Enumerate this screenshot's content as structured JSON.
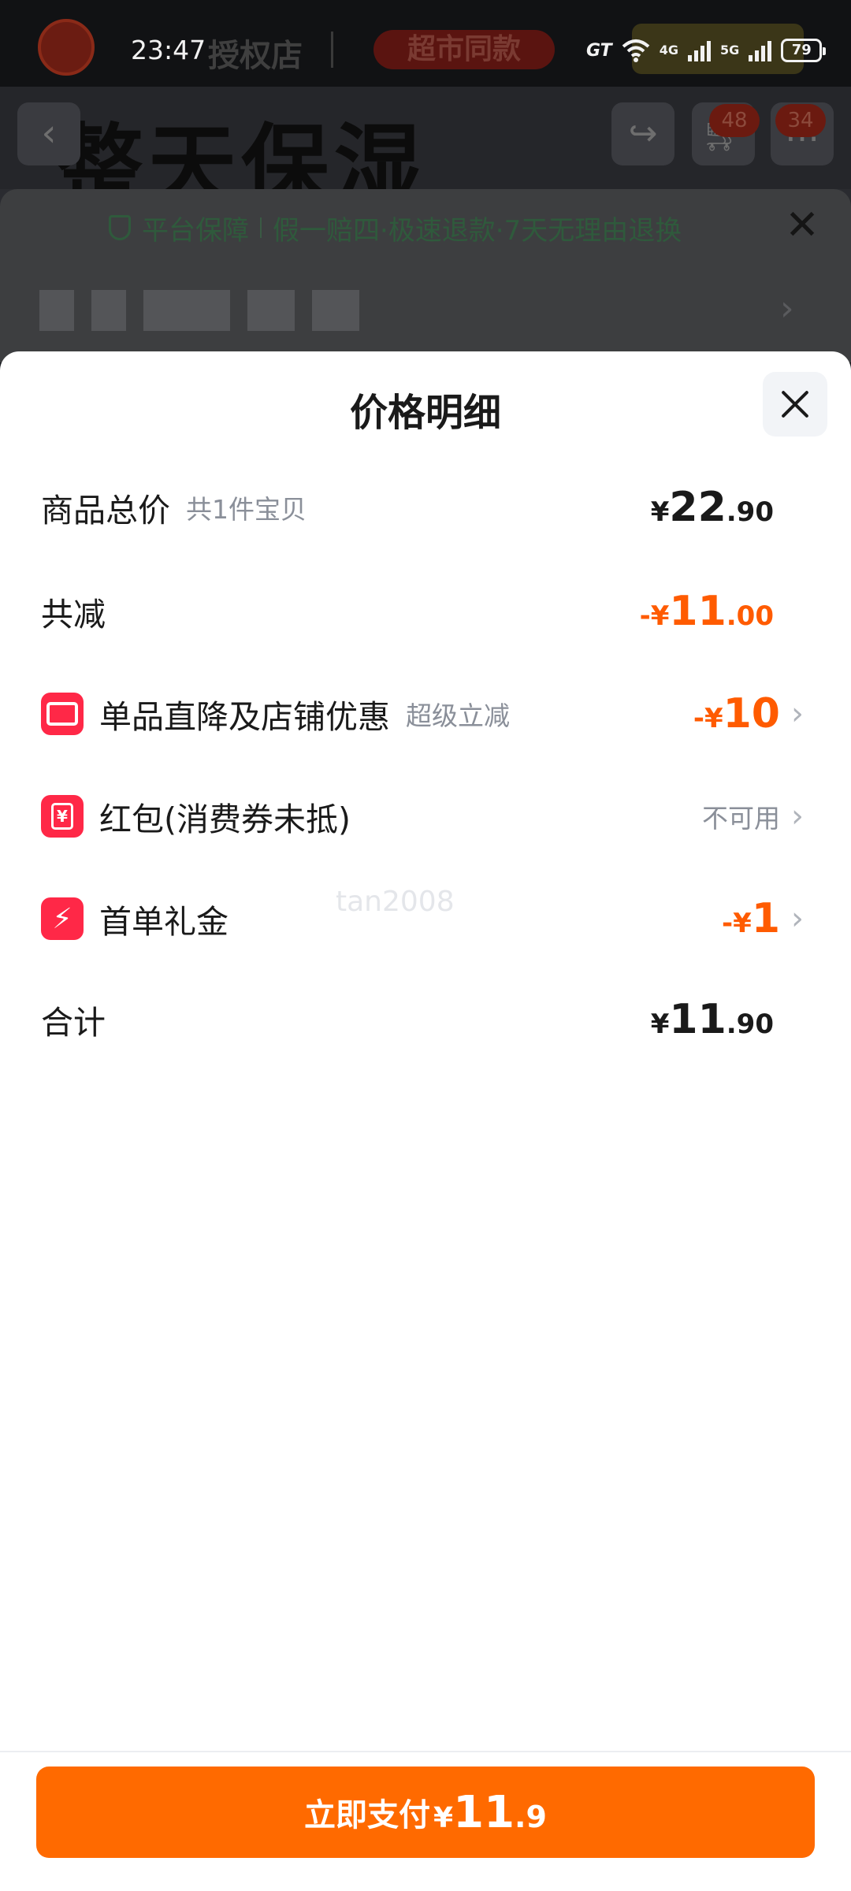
{
  "status_bar": {
    "time": "23:47",
    "network_badge": "GT",
    "signal_1_label": "4G",
    "signal_2_label": "5G",
    "battery": "79"
  },
  "background": {
    "store_name": "授权店",
    "tag": "超市同款",
    "headline": "整天保湿",
    "cart_badge": "48",
    "more_badge": "34",
    "guarantee_title": "平台保障",
    "guarantee_text": "假一赔四·极速退款·7天无理由退换"
  },
  "sheet": {
    "title": "价格明细",
    "rows": {
      "total": {
        "label": "商品总价",
        "sub": "共1件宝贝",
        "currency": "¥",
        "int": "22",
        "dec": ".90"
      },
      "discount": {
        "label": "共减",
        "currency": "-¥",
        "int": "11",
        "dec": ".00"
      },
      "item_discount": {
        "label": "单品直降及店铺优惠",
        "sub": "超级立减",
        "currency": "-¥",
        "int": "10"
      },
      "red_packet": {
        "label": "红包(消费券未抵)",
        "value": "不可用",
        "icon_glyph": "¥"
      },
      "first_order": {
        "label": "首单礼金",
        "currency": "-¥",
        "int": "1"
      },
      "sum": {
        "label": "合计",
        "currency": "¥",
        "int": "11",
        "dec": ".90"
      }
    },
    "watermark": "tan2008"
  },
  "footer": {
    "pay_label": "立即支付",
    "currency": "¥",
    "int": "11",
    "dec": ".9"
  },
  "colors": {
    "accent_orange": "#ff5b00",
    "pay_button": "#ff6a00",
    "icon_red": "#ff2847",
    "muted_text": "#8a8f99"
  },
  "icons": [
    "close-icon",
    "store-icon",
    "coupon-icon",
    "bolt-icon",
    "chevron-right-icon",
    "shield-icon",
    "back-icon",
    "share-icon",
    "cart-icon",
    "more-icon",
    "wifi-icon",
    "signal-icon",
    "battery-icon"
  ]
}
